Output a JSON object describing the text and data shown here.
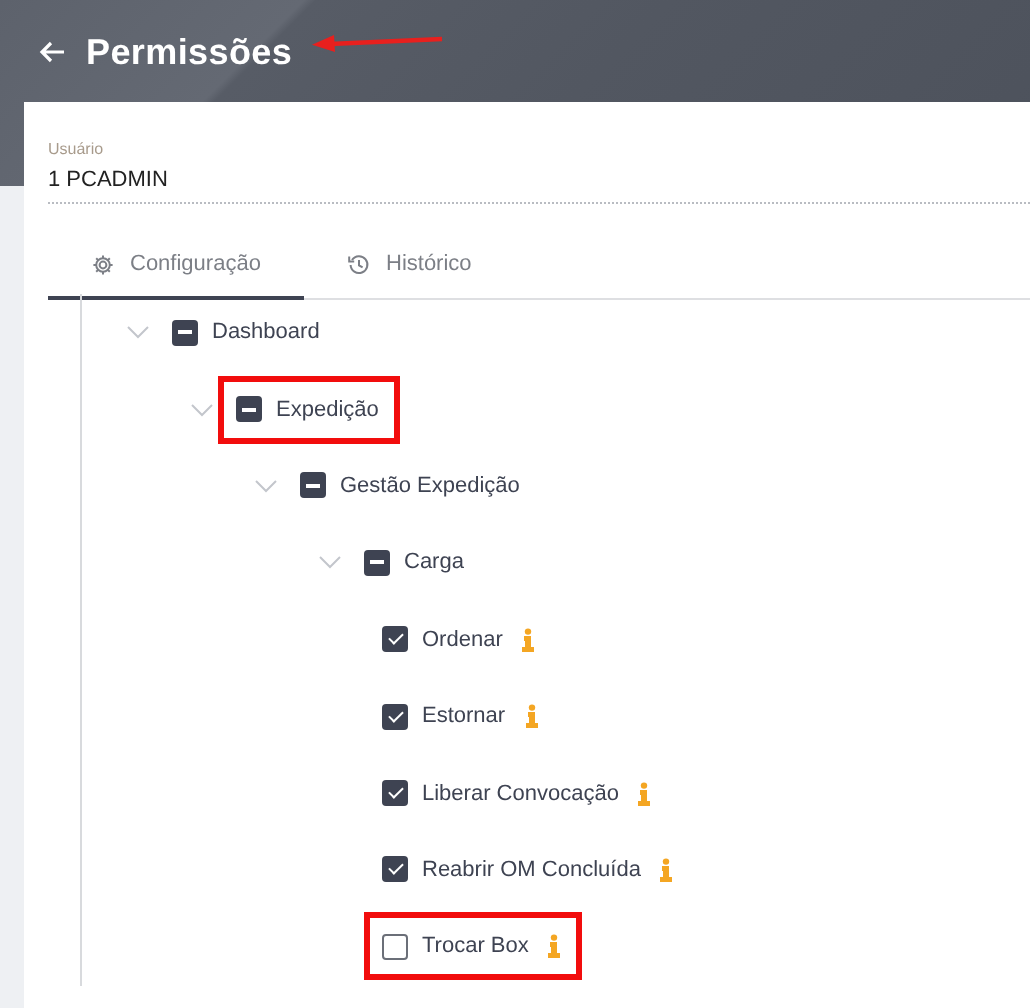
{
  "header": {
    "title": "Permissões"
  },
  "user_field": {
    "label": "Usuário",
    "value": "1 PCADMIN"
  },
  "tabs": [
    {
      "label": "Configuração",
      "selected": true
    },
    {
      "label": "Histórico",
      "selected": false
    }
  ],
  "tree": [
    {
      "label": "Dashboard",
      "expanded": true,
      "indeterminate": true,
      "highlighted": false,
      "children": [
        {
          "label": "Expedição",
          "expanded": true,
          "indeterminate": true,
          "highlighted": true,
          "children": [
            {
              "label": "Gestão Expedição",
              "expanded": true,
              "indeterminate": true,
              "highlighted": false,
              "children": [
                {
                  "label": "Carga",
                  "expanded": true,
                  "indeterminate": true,
                  "highlighted": false,
                  "children": [
                    {
                      "label": "Ordenar",
                      "checked": true,
                      "highlighted": false
                    },
                    {
                      "label": "Estornar",
                      "checked": true,
                      "highlighted": false
                    },
                    {
                      "label": "Liberar Convocação",
                      "checked": true,
                      "highlighted": false
                    },
                    {
                      "label": "Reabrir OM Concluída",
                      "checked": true,
                      "highlighted": false
                    },
                    {
                      "label": "Trocar Box",
                      "checked": false,
                      "highlighted": true
                    }
                  ]
                }
              ]
            }
          ]
        }
      ]
    }
  ]
}
